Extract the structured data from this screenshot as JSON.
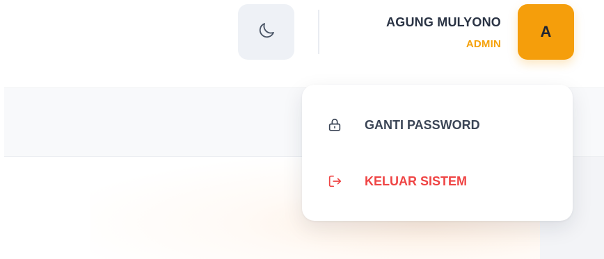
{
  "header": {
    "theme_toggle_icon": "moon-icon",
    "user": {
      "name": "AGUNG MULYONO",
      "role": "ADMIN",
      "avatar_initial": "A"
    }
  },
  "user_menu": {
    "items": [
      {
        "label": "GANTI PASSWORD",
        "icon": "lock-icon"
      },
      {
        "label": "KELUAR SISTEM",
        "icon": "logout-icon"
      }
    ]
  },
  "colors": {
    "accent": "#f59e0b",
    "danger": "#ef4444",
    "text": "#2a3344"
  }
}
